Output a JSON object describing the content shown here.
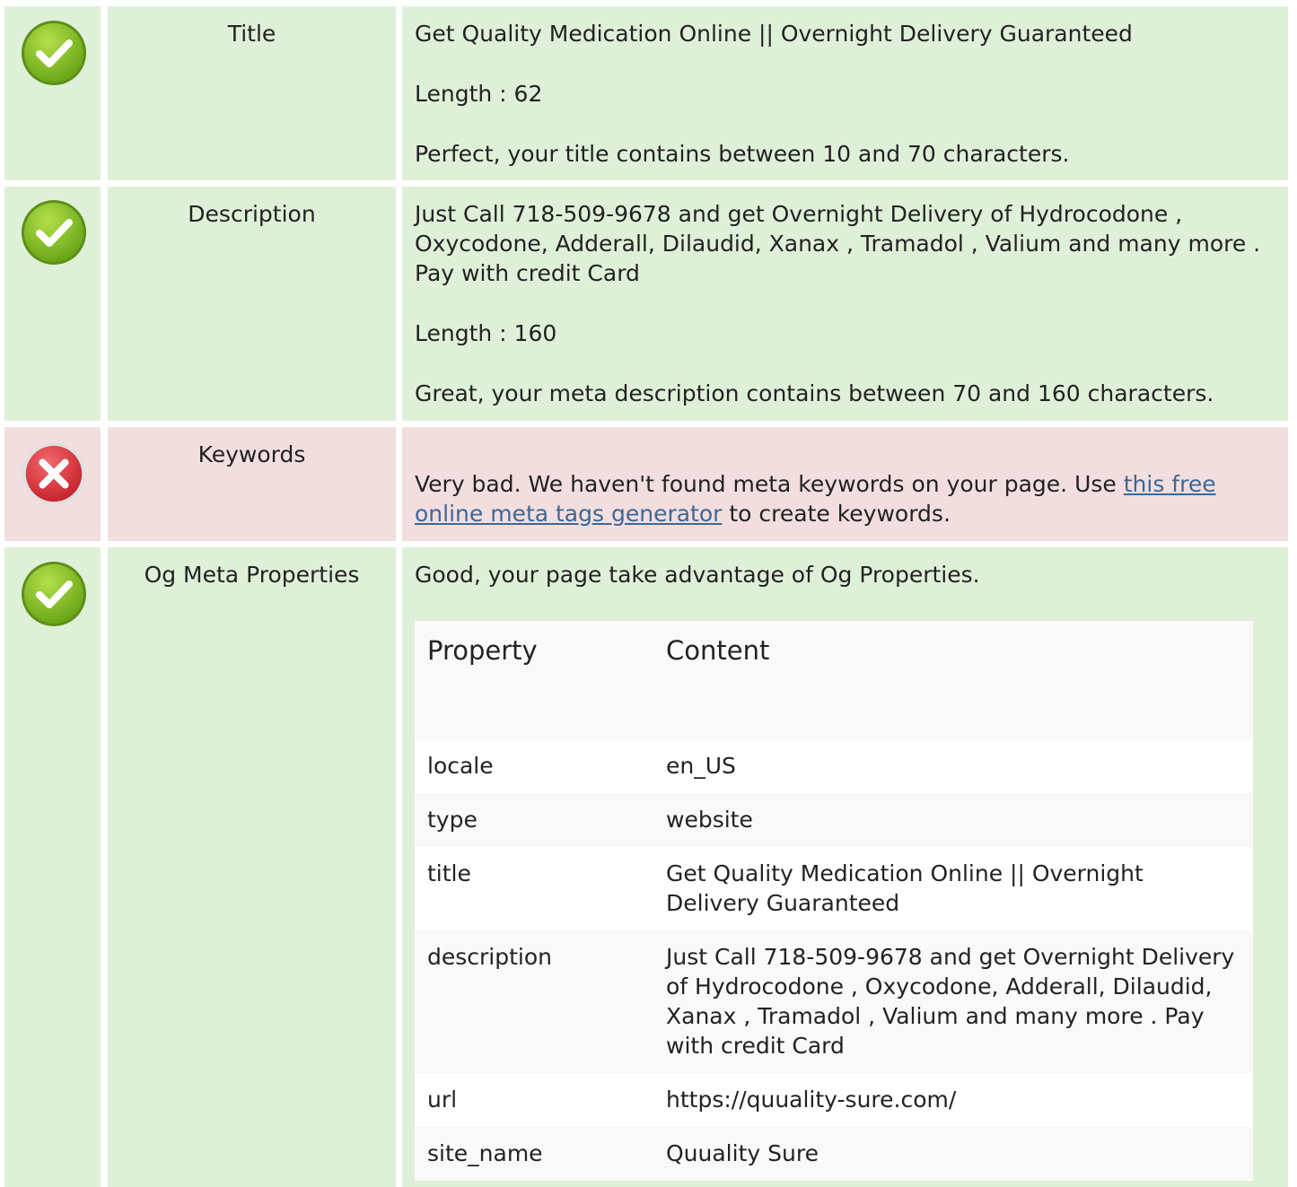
{
  "colors": {
    "good_bg": "#dff0d8",
    "bad_bg": "#f2dede",
    "link": "#3c6796",
    "good_icon": "#7ab51d",
    "bad_icon": "#d9363e"
  },
  "title_row": {
    "status_icon": "check-circle-icon",
    "label": "Title",
    "value": "Get Quality Medication Online || Overnight Delivery Guaranteed",
    "length": "Length : 62",
    "verdict": "Perfect, your title contains between 10 and 70 characters."
  },
  "description_row": {
    "status_icon": "check-circle-icon",
    "label": "Description",
    "value": "Just Call 718-509-9678 and get Overnight Delivery of Hydrocodone , Oxycodone, Adderall, Dilaudid, Xanax , Tramadol , Valium and many more . Pay with credit Card",
    "length": "Length : 160",
    "verdict": "Great, your meta description contains between 70 and 160 characters."
  },
  "keywords_row": {
    "status_icon": "x-circle-icon",
    "label": "Keywords",
    "verdict_before": "Very bad. We haven't found meta keywords on your page. Use ",
    "link_text": "this free online meta tags generator",
    "verdict_after": " to create keywords."
  },
  "og_row": {
    "status_icon": "check-circle-icon",
    "label": "Og Meta Properties",
    "verdict": "Good, your page take advantage of Og Properties.",
    "table": {
      "headers": [
        "Property",
        "Content"
      ],
      "rows": [
        {
          "property": "locale",
          "content": "en_US"
        },
        {
          "property": "type",
          "content": "website"
        },
        {
          "property": "title",
          "content": "Get Quality Medication Online || Overnight Delivery Guaranteed"
        },
        {
          "property": "description",
          "content": "Just Call 718-509-9678 and get Overnight Delivery of Hydrocodone , Oxycodone, Adderall, Dilaudid, Xanax , Tramadol , Valium and many more . Pay with credit Card"
        },
        {
          "property": "url",
          "content": "https://quuality-sure.com/"
        },
        {
          "property": "site_name",
          "content": "Quuality Sure"
        }
      ]
    }
  }
}
